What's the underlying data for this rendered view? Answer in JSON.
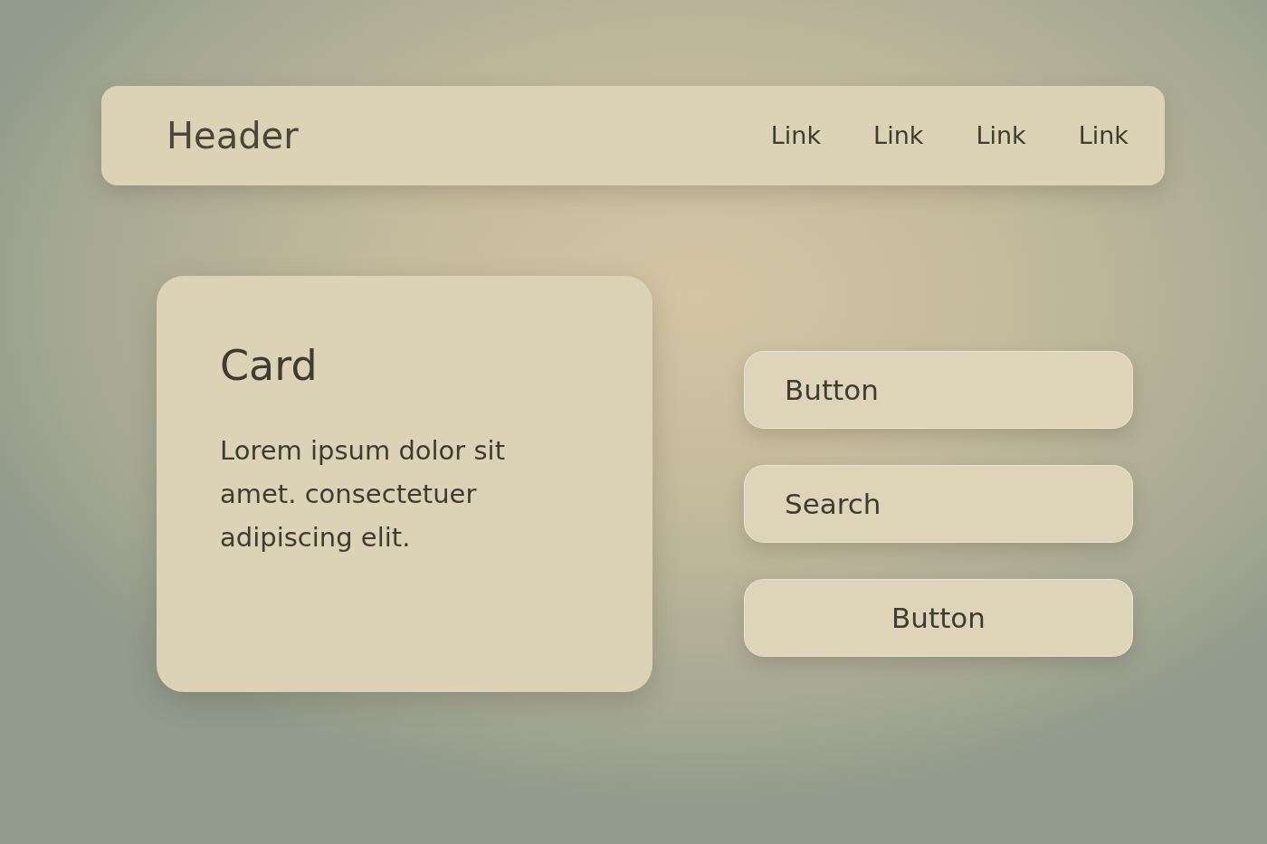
{
  "header": {
    "title": "Header",
    "links": [
      "Link",
      "Link",
      "Link",
      "Link"
    ]
  },
  "card": {
    "title": "Card",
    "text": "Lorem ipsum dolor sit amet. consectetuer adipiscing elit."
  },
  "controls": [
    {
      "kind": "button",
      "label": "Button",
      "centered": false
    },
    {
      "kind": "search",
      "placeholder": "Search"
    },
    {
      "kind": "button",
      "label": "Button",
      "centered": true
    }
  ]
}
